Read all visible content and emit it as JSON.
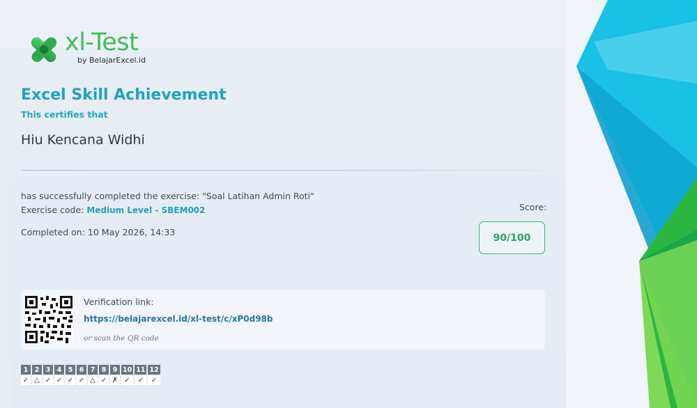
{
  "logo": {
    "name": "xl-Test",
    "sub": "by BelajarExcel.id"
  },
  "certificate": {
    "title": "Excel Skill Achievement",
    "certifies": "This certifies that",
    "recipient": "Hiu Kencana Widhi",
    "completed_text": "has successfully completed the exercise: \"Soal Latihan Admin Roti\"",
    "code_label": "Exercise code: ",
    "code_value": "Medium Level - SBEM002",
    "completed_on": "Completed on: 10 May 2026, 14:33",
    "score_label": "Score:",
    "score": "90/100"
  },
  "verification": {
    "label": "Verification link:",
    "link": "https://belajarexcel.id/xl-test/c/xP0d98b",
    "scan": "or scan the QR code"
  },
  "questions": [
    {
      "n": "1",
      "mark": "✓"
    },
    {
      "n": "2",
      "mark": "△"
    },
    {
      "n": "3",
      "mark": "✓"
    },
    {
      "n": "4",
      "mark": "✓"
    },
    {
      "n": "5",
      "mark": "✓"
    },
    {
      "n": "6",
      "mark": "✓"
    },
    {
      "n": "7",
      "mark": "△"
    },
    {
      "n": "8",
      "mark": "✓"
    },
    {
      "n": "9",
      "mark": "✗"
    },
    {
      "n": "10",
      "mark": "✓"
    },
    {
      "n": "11",
      "mark": "✓"
    },
    {
      "n": "12",
      "mark": "✓"
    }
  ],
  "colors": {
    "accent": "#1fa3c0",
    "score": "#2aa45a",
    "logo": "#3fbe59"
  }
}
